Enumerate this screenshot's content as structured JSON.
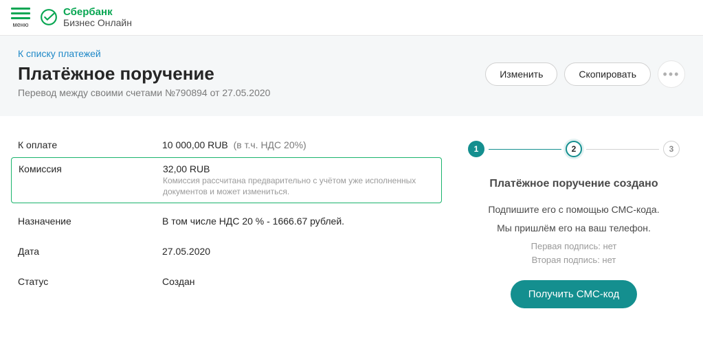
{
  "header": {
    "menu_label": "меню",
    "brand_top": "Сбербанк",
    "brand_bottom": "Бизнес Онлайн"
  },
  "page": {
    "back_link": "К списку платежей",
    "title": "Платёжное поручение",
    "subtitle": "Перевод между своими счетами №790894 от 27.05.2020"
  },
  "actions": {
    "edit": "Изменить",
    "copy": "Скопировать"
  },
  "details": {
    "amount_label": "К оплате",
    "amount_value": "10 000,00 RUB",
    "amount_suffix": "(в т.ч. НДС 20%)",
    "fee_label": "Комиссия",
    "fee_value": "32,00 RUB",
    "fee_note": "Комиссия рассчитана предварительно с учётом уже исполненных документов и может измениться.",
    "purpose_label": "Назначение",
    "purpose_value": "В том числе НДС 20 % - 1666.67 рублей.",
    "date_label": "Дата",
    "date_value": "27.05.2020",
    "status_label": "Статус",
    "status_value": "Создан"
  },
  "wizard": {
    "step1": "1",
    "step2": "2",
    "step3": "3",
    "title": "Платёжное поручение создано",
    "line1": "Подпишите его с помощью СМС-кода.",
    "line2": "Мы пришлём его на ваш телефон.",
    "sign1": "Первая подпись: нет",
    "sign2": "Вторая подпись: нет",
    "cta": "Получить СМС-код"
  }
}
